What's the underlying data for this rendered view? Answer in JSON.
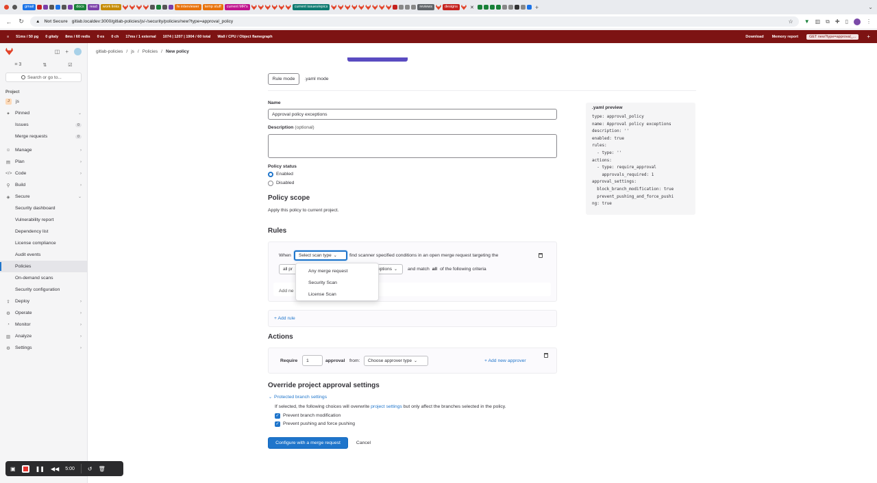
{
  "browser": {
    "tabs": [
      {
        "label": "gmail",
        "color": "#1a73e8"
      },
      {
        "label": "docs",
        "color": "#188038"
      },
      {
        "label": "read",
        "color": "#7b3fa8"
      },
      {
        "label": "work links",
        "color": "#c58a00"
      },
      {
        "label": "fe interviewer",
        "color": "#e8710a"
      },
      {
        "label": "temp stuff",
        "color": "#e8710a"
      },
      {
        "label": "current MR's",
        "color": "#c0138e"
      },
      {
        "label": "current issues/epics",
        "color": "#0d7a70"
      },
      {
        "label": "reviews",
        "color": "#5f6368"
      },
      {
        "label": "designs",
        "color": "#c5221f"
      }
    ],
    "url_security": "Not Secure",
    "url": "gitlab.localdev:3000/gitlab-policies/js/-/security/policies/new?type=approval_policy"
  },
  "perfbar": {
    "items": [
      "51ms / 50 pg",
      "0 gitaly",
      "8ms / 60 redis",
      "0 es",
      "0 ch",
      "17ms / 1 external",
      "1074 | 1207 | 1904 / 60 total",
      "Wall / CPU / Object flamegraph"
    ],
    "download": "Download",
    "memory_report": "Memory report",
    "request": "GET new?type=approval_..."
  },
  "sidebar": {
    "counters": [
      "3",
      "⇅",
      "☑"
    ],
    "search_placeholder": "Search or go to...",
    "section_label": "Project",
    "project_name": "js",
    "project_initial": "J",
    "pinned": "Pinned",
    "pinned_items": [
      {
        "label": "Issues",
        "count": "0"
      },
      {
        "label": "Merge requests",
        "count": "0"
      }
    ],
    "groups_top": [
      {
        "label": "Manage",
        "icon": "users-icon"
      },
      {
        "label": "Plan",
        "icon": "plan-icon"
      },
      {
        "label": "Code",
        "icon": "code-icon"
      },
      {
        "label": "Build",
        "icon": "rocket-icon"
      },
      {
        "label": "Secure",
        "icon": "shield-icon"
      }
    ],
    "secure_items": [
      "Security dashboard",
      "Vulnerability report",
      "Dependency list",
      "License compliance",
      "Audit events",
      "Policies",
      "On-demand scans",
      "Security configuration"
    ],
    "groups_bottom": [
      {
        "label": "Deploy",
        "icon": "deploy-icon"
      },
      {
        "label": "Operate",
        "icon": "operate-icon"
      },
      {
        "label": "Monitor",
        "icon": "monitor-icon"
      },
      {
        "label": "Analyze",
        "icon": "chart-icon"
      },
      {
        "label": "Settings",
        "icon": "gear-icon"
      }
    ]
  },
  "breadcrumb": [
    "gitlab-policies",
    "js",
    "Policies",
    "New policy"
  ],
  "form": {
    "mode_rule": "Rule mode",
    "mode_yaml": ".yaml mode",
    "name_label": "Name",
    "name_value": "Approval policy exceptions",
    "description_label": "Description",
    "description_optional": "(optional)",
    "status_label": "Policy status",
    "status_enabled": "Enabled",
    "status_disabled": "Disabled",
    "scope_title": "Policy scope",
    "scope_text": "Apply this policy to current project.",
    "rules_title": "Rules",
    "rule_when": "When",
    "rule_select": "Select scan type",
    "rule_sentence": "find scanner specified conditions in an open merge request targeting the",
    "rule_all_prefix": "all pr",
    "rule_exceptions": "eptions",
    "rule_and_match": "and match",
    "rule_all": "all",
    "rule_criteria": "of the following criteria",
    "rule_add_new": "Add ne",
    "dropdown_options": [
      "Any merge request",
      "Security Scan",
      "License Scan"
    ],
    "add_rule": "+ Add rule",
    "actions_title": "Actions",
    "require": "Require",
    "approvals_value": "1",
    "approval_word": "approval",
    "from_word": "from:",
    "approver_select": "Choose approver type",
    "add_approver": "+ Add new approver",
    "override_title": "Override project approval settings",
    "protected_toggle": "Protected branch settings",
    "override_text_pre": "If selected, the following choices will overwrite",
    "override_link": "project settings",
    "override_text_post": "but only affect the branches selected in the policy.",
    "check_prevent_modification": "Prevent branch modification",
    "check_prevent_push": "Prevent pushing and force pushing",
    "submit": "Configure with a merge request",
    "cancel": "Cancel"
  },
  "yaml_preview": {
    "title": ".yaml preview",
    "content": "type: approval_policy\nname: Approval policy exceptions\ndescription: ''\nenabled: true\nrules:\n  - type: ''\nactions:\n  - type: require_approval\n    approvals_required: 1\napproval_settings:\n  block_branch_modification: true\n  prevent_pushing_and_force_pushi\nng: true"
  },
  "recorder": {
    "time": "5:00"
  }
}
